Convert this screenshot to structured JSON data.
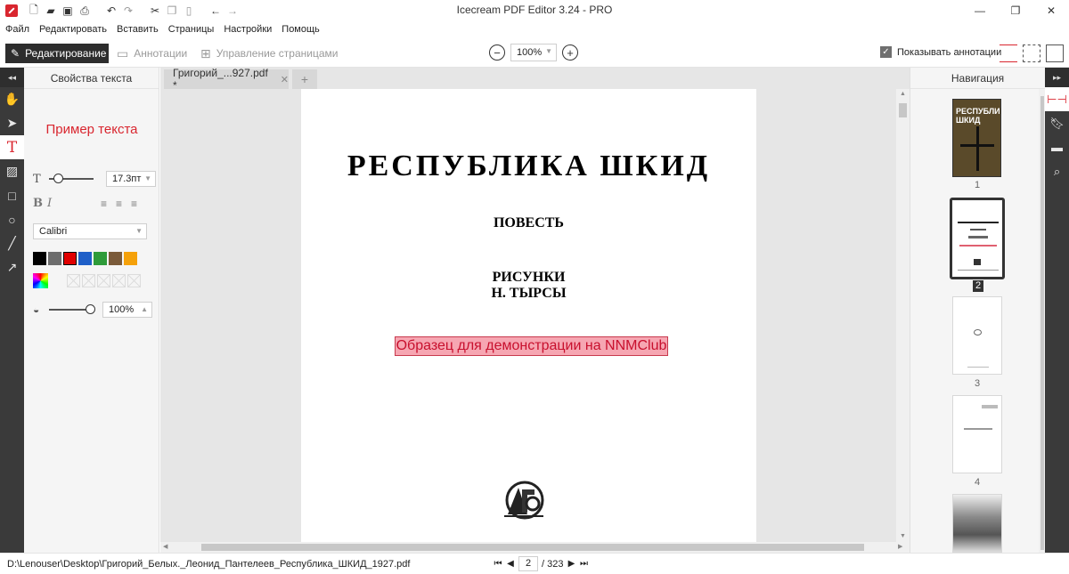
{
  "window": {
    "title": "Icecream PDF Editor 3.24 - PRO",
    "minimize": "—",
    "maximize": "❐",
    "close": "✕"
  },
  "quick_access": [
    "new-file-icon",
    "open-folder-icon",
    "save-icon",
    "print-icon",
    "undo-icon",
    "redo-icon",
    "cut-icon",
    "copy-icon",
    "paste-icon",
    "back-icon",
    "forward-icon"
  ],
  "menu": [
    "Файл",
    "Редактировать",
    "Вставить",
    "Страницы",
    "Настройки",
    "Помощь"
  ],
  "modes": {
    "edit": "Редактирование",
    "annotations": "Аннотации",
    "pages": "Управление страницами"
  },
  "zoom": {
    "value": "100%",
    "minus": "−",
    "plus": "+"
  },
  "show_annotations": {
    "label": "Показывать аннотации",
    "checked": true
  },
  "text_props": {
    "header": "Свойства текста",
    "sample": "Пример текста",
    "font_size": "17.3пт",
    "font_size_slider": 0.2,
    "bold": "B",
    "italic": "I",
    "font_family": "Calibri",
    "colors": [
      "#000000",
      "#6d6d6d",
      "#e00000",
      "#1f5fc8",
      "#2e9b3a",
      "#7a5a3a",
      "#f5a10a"
    ],
    "selected_color": "#e00000",
    "opacity": "100%",
    "opacity_slider": 1.0
  },
  "tools": [
    "hand-icon",
    "select-icon",
    "text-icon",
    "image-icon",
    "rectangle-icon",
    "ellipse-icon",
    "line-icon",
    "arrow-icon"
  ],
  "tab": {
    "label": "Григорий_...927.pdf *",
    "close": "✕",
    "add": "+"
  },
  "page": {
    "title": "РЕСПУБЛИКА ШКИД",
    "subtitle": "ПОВЕСТЬ",
    "line1": "РИСУНКИ",
    "line2": "Н. ТЫРСЫ",
    "annotation": "Образец для демонстрации на NNMClub"
  },
  "navigation": {
    "header": "Навигация",
    "thumbs": [
      {
        "num": "1",
        "cover_text": "РЕСПУБЛИКА ШКИД"
      },
      {
        "num": "2",
        "selected": true
      },
      {
        "num": "3"
      },
      {
        "num": "4"
      }
    ]
  },
  "right_icons": [
    "navigation-icon",
    "bookmark-icon",
    "comment-icon",
    "search-icon"
  ],
  "status": {
    "path": "D:\\Lenouser\\Desktop\\Григорий_Белых._Леонид_Пантелеев_Республика_ШКИД_1927.pdf",
    "current_page": "2",
    "total": "/ 323"
  }
}
